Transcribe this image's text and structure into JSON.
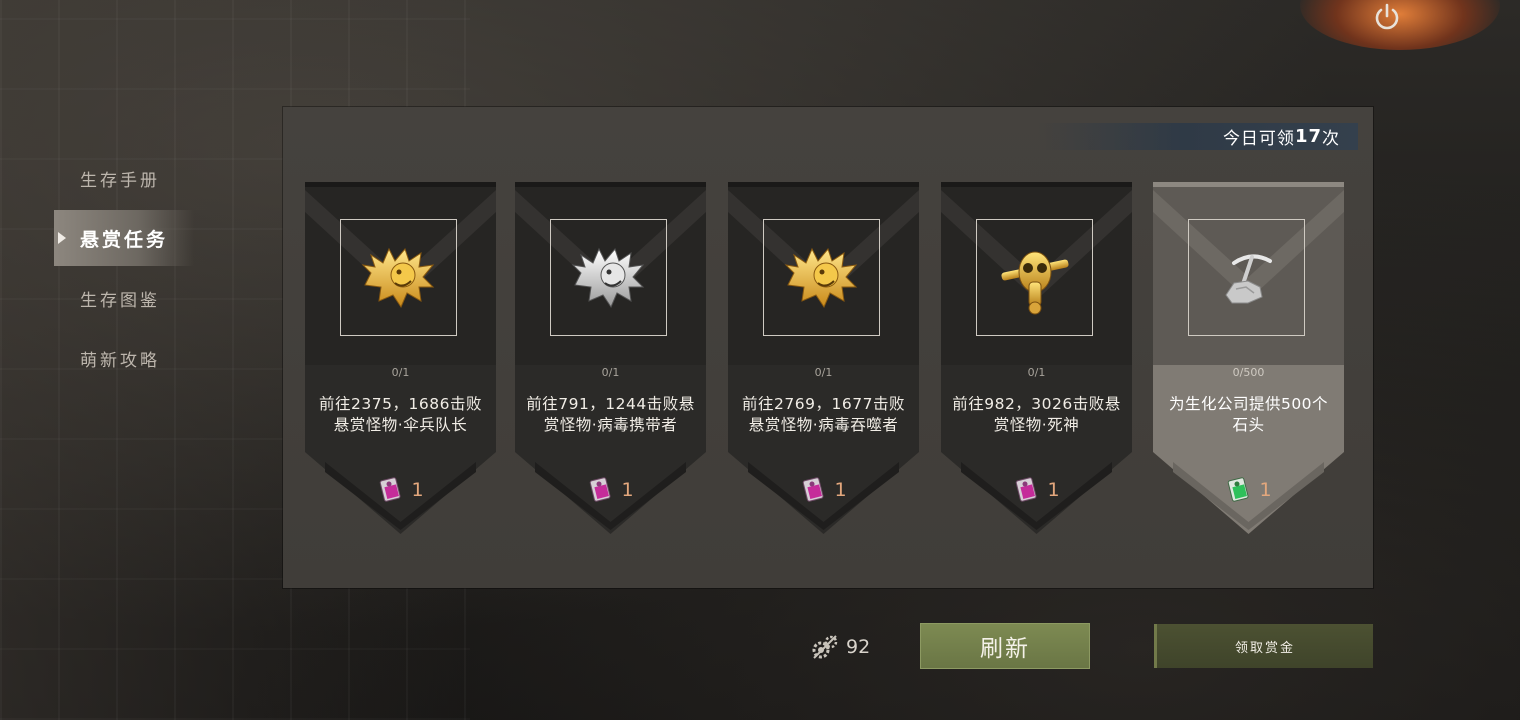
{
  "side_menu": {
    "items": [
      {
        "label": "生存手册",
        "active": false
      },
      {
        "label": "悬赏任务",
        "active": true
      },
      {
        "label": "生存图鉴",
        "active": false
      },
      {
        "label": "萌新攻略",
        "active": false
      }
    ]
  },
  "panel": {
    "daily_prefix": "今日可领",
    "daily_count": "17",
    "daily_suffix": "次"
  },
  "cards": [
    {
      "icon": "gold-lion-head-icon",
      "progress": "0/1",
      "desc_line1": "前往2375，1686击败",
      "desc_line2": "悬赏怪物·伞兵队长",
      "reward_icon": "pink-card-ticket-icon",
      "reward_count": "1"
    },
    {
      "icon": "silver-lion-head-icon",
      "progress": "0/1",
      "desc_line1": "前往791，1244击败悬",
      "desc_line2": "赏怪物·病毒携带者",
      "reward_icon": "pink-card-ticket-icon",
      "reward_count": "1"
    },
    {
      "icon": "gold-lion-head-icon",
      "progress": "0/1",
      "desc_line1": "前往2769，1677击败",
      "desc_line2": "悬赏怪物·病毒吞噬者",
      "reward_icon": "pink-card-ticket-icon",
      "reward_count": "1"
    },
    {
      "icon": "gold-gasmask-skull-icon",
      "progress": "0/1",
      "desc_line1": "前往982，3026击败悬",
      "desc_line2": "赏怪物·死神",
      "reward_icon": "pink-card-ticket-icon",
      "reward_count": "1"
    },
    {
      "icon": "pickaxe-stone-icon",
      "progress": "0/500",
      "desc_line1": "为生化公司提供500个",
      "desc_line2": "石头",
      "reward_icon": "green-card-ticket-icon",
      "reward_count": "1"
    }
  ],
  "bottom": {
    "currency_icon": "gears-currency-icon",
    "currency_value": "92",
    "refresh_label": "刷新",
    "claim_label": "领取赏金"
  },
  "colors": {
    "refresh_bg": "#7d8a52",
    "claim_bg": "#4c5132",
    "reward_count": "#e3a77d",
    "daily_bar": "#34404d"
  }
}
